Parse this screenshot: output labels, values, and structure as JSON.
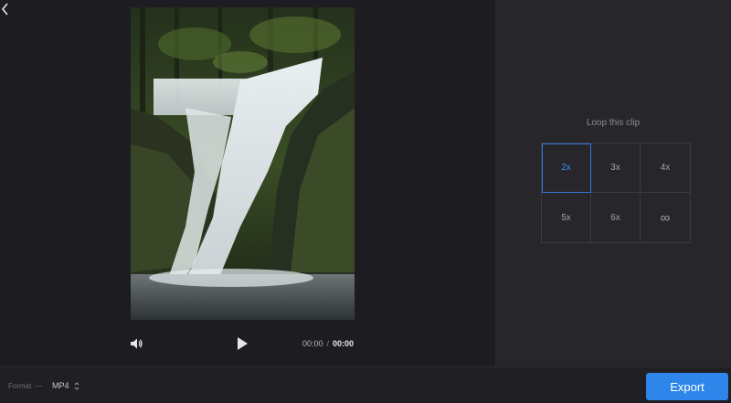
{
  "player": {
    "time_current": "00:00",
    "time_separator": "/",
    "time_duration": "00:00",
    "icons": {
      "back": "chevron-left-icon",
      "volume": "volume-icon",
      "play": "play-icon"
    }
  },
  "loop": {
    "title": "Loop this clip",
    "options": [
      {
        "label": "2x",
        "selected": true
      },
      {
        "label": "3x",
        "selected": false
      },
      {
        "label": "4x",
        "selected": false
      },
      {
        "label": "5x",
        "selected": false
      },
      {
        "label": "6x",
        "selected": false
      },
      {
        "label": "∞",
        "selected": false
      }
    ]
  },
  "footer": {
    "format_label": "Format",
    "format_dash": "—",
    "format_value": "MP4",
    "export_label": "Export"
  },
  "colors": {
    "accent": "#2f86ea",
    "selected_text": "#3d8bf2",
    "panel": "#26262b",
    "background": "#1c1c21"
  }
}
